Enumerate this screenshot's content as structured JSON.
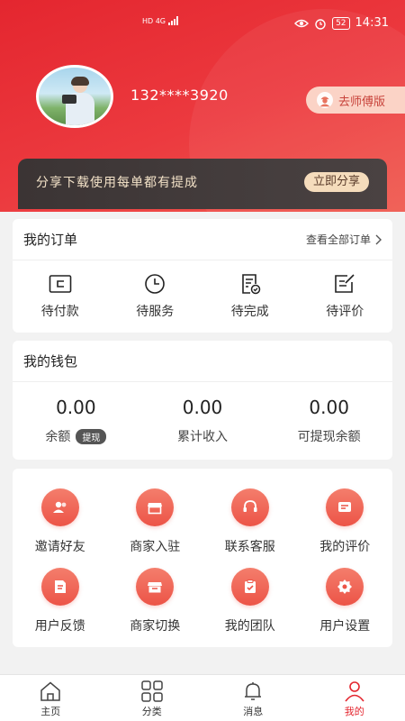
{
  "status_bar": {
    "network": "HD 4G",
    "time": "14:31",
    "battery": "52"
  },
  "profile": {
    "phone": "132****3920",
    "mentor_button": "去师傅版"
  },
  "share_banner": {
    "text": "分享下载使用每单都有提成",
    "button": "立即分享"
  },
  "orders": {
    "title": "我的订单",
    "view_all": "查看全部订单",
    "items": [
      {
        "label": "待付款",
        "icon": "wallet-icon"
      },
      {
        "label": "待服务",
        "icon": "clock-icon"
      },
      {
        "label": "待完成",
        "icon": "document-check-icon"
      },
      {
        "label": "待评价",
        "icon": "edit-icon"
      }
    ]
  },
  "wallet": {
    "title": "我的钱包",
    "balance": {
      "value": "0.00",
      "label": "余额",
      "tag": "提现"
    },
    "total_income": {
      "value": "0.00",
      "label": "累计收入"
    },
    "withdrawable": {
      "value": "0.00",
      "label": "可提现余额"
    }
  },
  "services": [
    {
      "label": "邀请好友",
      "icon": "users-icon"
    },
    {
      "label": "商家入驻",
      "icon": "store-icon"
    },
    {
      "label": "联系客服",
      "icon": "headset-icon"
    },
    {
      "label": "我的评价",
      "icon": "comment-icon"
    },
    {
      "label": "用户反馈",
      "icon": "feedback-icon"
    },
    {
      "label": "商家切换",
      "icon": "switch-store-icon"
    },
    {
      "label": "我的团队",
      "icon": "team-icon"
    },
    {
      "label": "用户设置",
      "icon": "settings-icon"
    }
  ],
  "tabs": [
    {
      "label": "主页",
      "icon": "home-icon"
    },
    {
      "label": "分类",
      "icon": "grid-icon"
    },
    {
      "label": "消息",
      "icon": "bell-icon"
    },
    {
      "label": "我的",
      "icon": "user-icon",
      "active": true
    }
  ],
  "colors": {
    "brand_red": "#e4262f",
    "accent_orange": "#ec5447",
    "banner_gold": "#f5dcbc"
  }
}
